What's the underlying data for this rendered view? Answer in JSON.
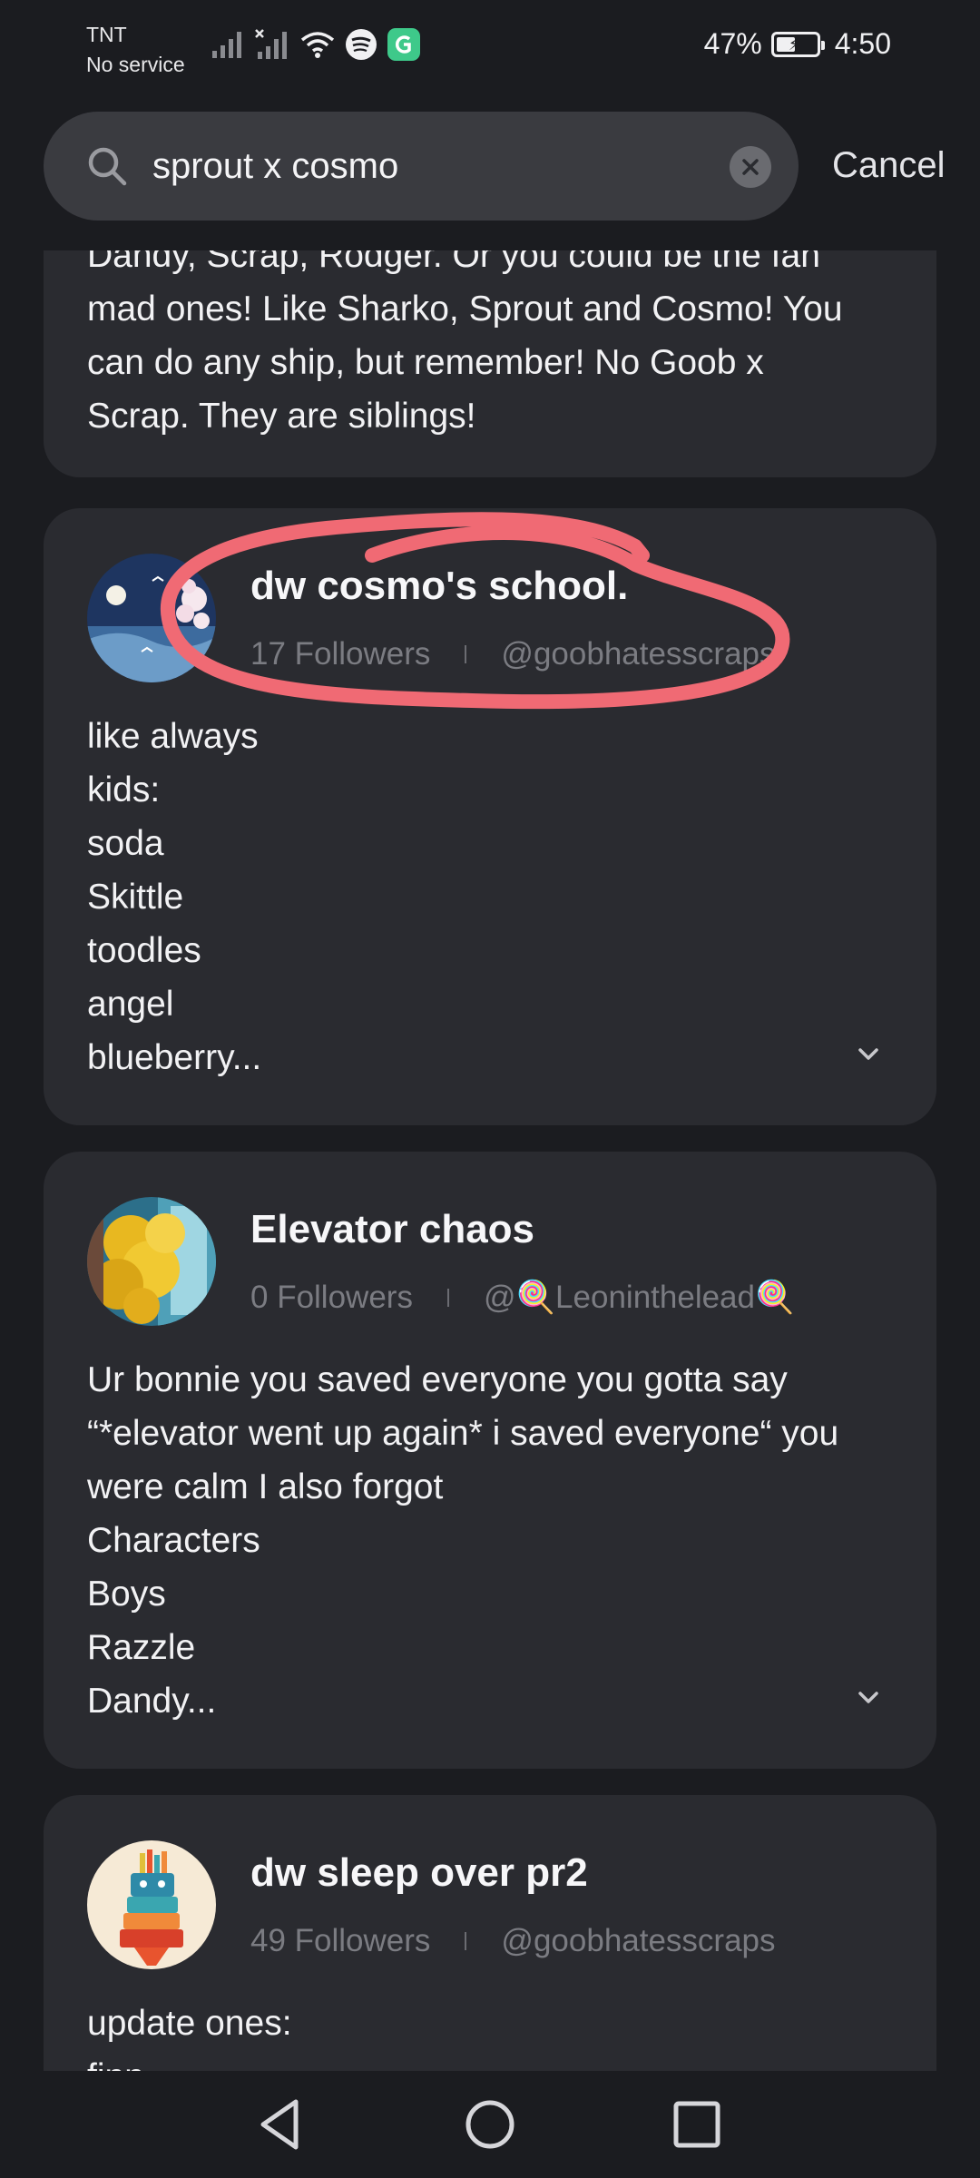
{
  "status": {
    "carrier_line1": "TNT",
    "carrier_line2": "No service",
    "battery_percent": "47%",
    "battery_level": 0.47,
    "time": "4:50",
    "icons": [
      "signal-bars-icon",
      "no-signal-icon",
      "wifi-icon",
      "spotify-icon",
      "app-notification-icon",
      "battery-icon"
    ]
  },
  "search": {
    "query": "sprout x cosmo",
    "cancel_label": "Cancel"
  },
  "results": [
    {
      "body": "Dandy, Scrap, Rodger. Or you could be the fan\nmad ones! Like Sharko, Sprout and Cosmo! You\ncan do any ship, but remember! No Goob x\nScrap. They are siblings!"
    },
    {
      "title": "dw cosmo's school.",
      "followers": "17 Followers",
      "handle": "@goobhatesscraps",
      "body": "like always\nkids:\nsoda\nSkittle\ntoodles\nangel\nblueberry..."
    },
    {
      "title": "Elevator chaos",
      "followers": "0 Followers",
      "handle": "@🍭Leoninthelead🍭",
      "body": "Ur bonnie you saved everyone you gotta say\n“*elevator went up again* i saved everyone“ you\nwere calm I also forgot\nCharacters\nBoys\nRazzle\nDandy..."
    },
    {
      "title": "dw sleep over pr2",
      "followers": "49 Followers",
      "handle": "@goobhatesscraps",
      "body": "update ones:\nfinn"
    }
  ],
  "colors": {
    "background": "#1b1c20",
    "card": "#2a2b30",
    "search_field": "#3a3b40",
    "highlight_stroke": "#f06a74"
  }
}
